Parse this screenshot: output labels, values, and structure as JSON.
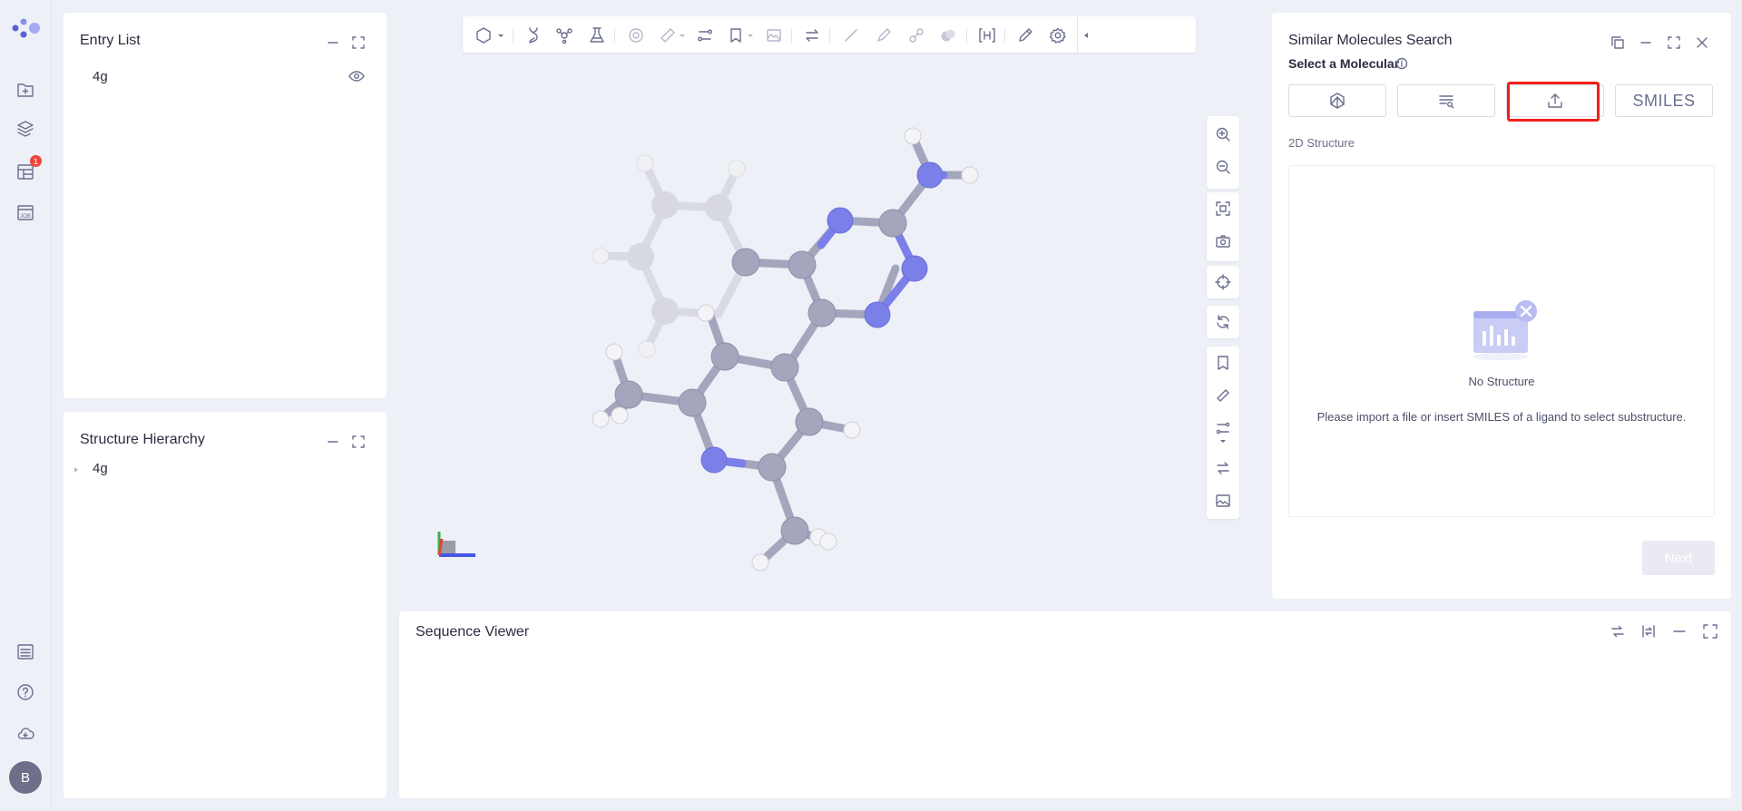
{
  "entry_list": {
    "title": "Entry List",
    "items": [
      {
        "label": "4g"
      }
    ]
  },
  "structure_hierarchy": {
    "title": "Structure Hierarchy",
    "items": [
      {
        "label": "4g"
      }
    ]
  },
  "sequence_viewer": {
    "title": "Sequence Viewer"
  },
  "rail": {
    "notification_count": "1",
    "user_initial": "B"
  },
  "similar_search": {
    "title": "Similar Molecules Search",
    "select_label": "Select a Molecular",
    "smiles_label": "SMILES",
    "structure_label": "2D Structure",
    "empty_title": "No Structure",
    "empty_hint": "Please import a file or insert SMILES of a ligand to select substructure.",
    "next_label": "Next"
  },
  "colors": {
    "accent": "#5b5fd6",
    "highlight": "#f0201a",
    "nitrogen": "#7b80e8",
    "carbon": "#a4a6bd",
    "hydrogen": "#f2f2f5"
  }
}
